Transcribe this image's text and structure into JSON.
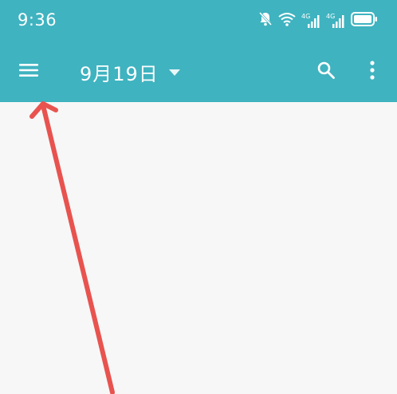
{
  "status_bar": {
    "time": "9:36",
    "icons": [
      "bell-muted-icon",
      "wifi-icon",
      "signal-4g-icon",
      "signal-4g-icon",
      "battery-icon"
    ],
    "network_label_1": "4G",
    "network_label_2": "4G"
  },
  "toolbar": {
    "menu_icon": "hamburger-menu-icon",
    "date_label": "9月19日",
    "dropdown_icon": "caret-down-icon",
    "search_icon": "search-icon",
    "more_icon": "more-vertical-icon"
  },
  "colors": {
    "appbar": "#3fb3c0",
    "background": "#f7f7f7",
    "annotation_arrow": "#e8534f"
  }
}
